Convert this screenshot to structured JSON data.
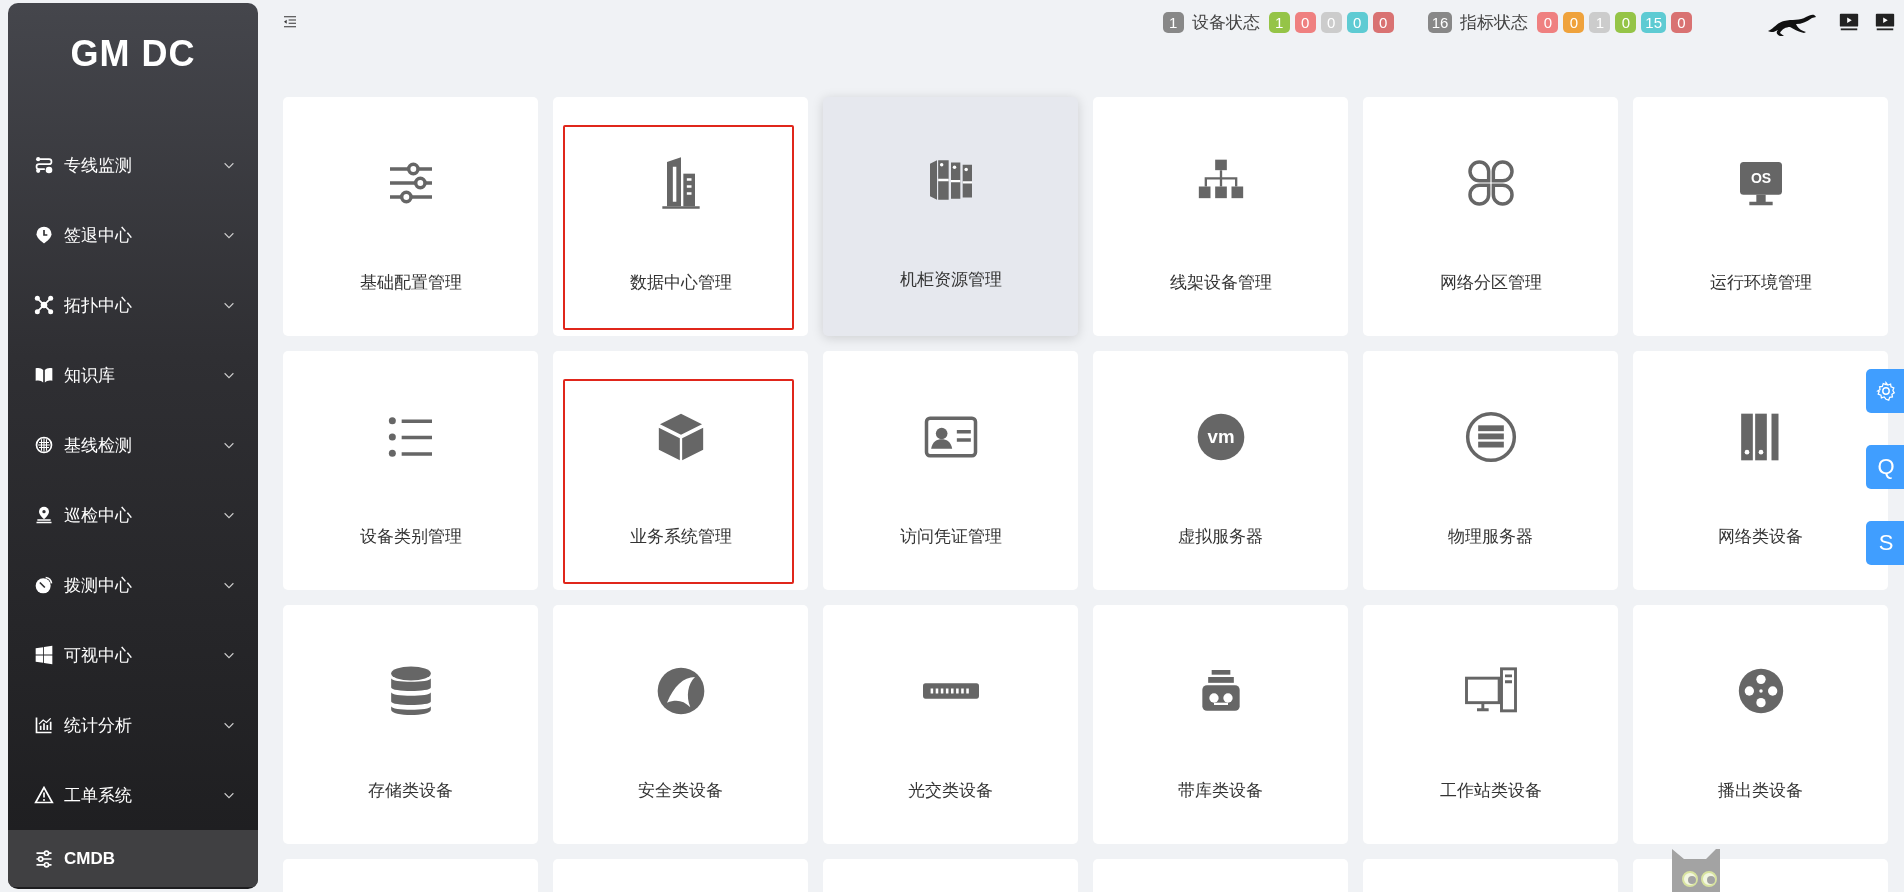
{
  "sidebar": {
    "logo": "GM DC",
    "items": [
      {
        "label": "专线监测",
        "expandable": true,
        "selected": false
      },
      {
        "label": "签退中心",
        "expandable": true,
        "selected": false
      },
      {
        "label": "拓扑中心",
        "expandable": true,
        "selected": false
      },
      {
        "label": "知识库",
        "expandable": true,
        "selected": false
      },
      {
        "label": "基线检测",
        "expandable": true,
        "selected": false
      },
      {
        "label": "巡检中心",
        "expandable": true,
        "selected": false
      },
      {
        "label": "拨测中心",
        "expandable": true,
        "selected": false
      },
      {
        "label": "可视中心",
        "expandable": true,
        "selected": false
      },
      {
        "label": "统计分析",
        "expandable": true,
        "selected": false
      },
      {
        "label": "工单系统",
        "expandable": true,
        "selected": false
      },
      {
        "label": "CMDB",
        "expandable": false,
        "selected": true
      }
    ]
  },
  "header": {
    "status_groups": [
      {
        "count": "1",
        "label": "设备状态",
        "badges": [
          {
            "value": "1",
            "color": "#95c447"
          },
          {
            "value": "0",
            "color": "#ef8080"
          },
          {
            "value": "0",
            "color": "#cccccc"
          },
          {
            "value": "0",
            "color": "#5ecbd3"
          },
          {
            "value": "0",
            "color": "#d97272"
          }
        ]
      },
      {
        "count": "16",
        "label": "指标状态",
        "badges": [
          {
            "value": "0",
            "color": "#ef8080"
          },
          {
            "value": "0",
            "color": "#efa23c"
          },
          {
            "value": "1",
            "color": "#cccccc"
          },
          {
            "value": "0",
            "color": "#95c447"
          },
          {
            "value": "15",
            "color": "#5ecbd3"
          },
          {
            "value": "0",
            "color": "#d97272"
          }
        ]
      }
    ]
  },
  "tiles": [
    {
      "label": "基础配置管理",
      "hovered": false,
      "highlighted": false
    },
    {
      "label": "数据中心管理",
      "hovered": false,
      "highlighted": true
    },
    {
      "label": "机柜资源管理",
      "hovered": true,
      "highlighted": false
    },
    {
      "label": "线架设备管理",
      "hovered": false,
      "highlighted": false
    },
    {
      "label": "网络分区管理",
      "hovered": false,
      "highlighted": false
    },
    {
      "label": "运行环境管理",
      "icon_text": "OS",
      "hovered": false,
      "highlighted": false
    },
    {
      "label": "设备类别管理",
      "hovered": false,
      "highlighted": false
    },
    {
      "label": "业务系统管理",
      "hovered": false,
      "highlighted": true
    },
    {
      "label": "访问凭证管理",
      "hovered": false,
      "highlighted": false
    },
    {
      "label": "虚拟服务器",
      "icon_text": "vm",
      "hovered": false,
      "highlighted": false
    },
    {
      "label": "物理服务器",
      "hovered": false,
      "highlighted": false
    },
    {
      "label": "网络类设备",
      "hovered": false,
      "highlighted": false
    },
    {
      "label": "存储类设备",
      "hovered": false,
      "highlighted": false
    },
    {
      "label": "安全类设备",
      "hovered": false,
      "highlighted": false
    },
    {
      "label": "光交类设备",
      "hovered": false,
      "highlighted": false
    },
    {
      "label": "带库类设备",
      "hovered": false,
      "highlighted": false
    },
    {
      "label": "工作站类设备",
      "hovered": false,
      "highlighted": false
    },
    {
      "label": "播出类设备",
      "hovered": false,
      "highlighted": false
    }
  ],
  "side_buttons": [
    {
      "kind": "icon"
    },
    {
      "kind": "text",
      "label": "Q"
    },
    {
      "kind": "text",
      "label": "S"
    }
  ]
}
